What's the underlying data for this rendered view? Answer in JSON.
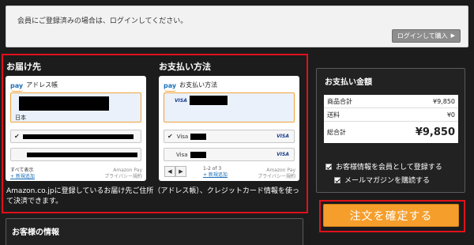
{
  "notice": {
    "text": "会員にご登録済みの場合は、ログインしてください。"
  },
  "login_button": {
    "label": "ログインして購入",
    "icon": "triangle-right-icon"
  },
  "address": {
    "section_title": "お届け先",
    "widget_title": "アドレス帳",
    "brand": "pay",
    "country": "日本",
    "show_all": "すべて表示",
    "add_new": "+ 新規追加",
    "footer_brand": "Amazon Pay",
    "footer_policy": "プライバシー規約"
  },
  "payment": {
    "section_title": "お支払い方法",
    "widget_title": "お支払い方法",
    "brand": "pay",
    "card_brand": "VISA",
    "card_label": "Visa",
    "pager_prev": "◀",
    "pager_next": "▶",
    "pager_text": "1-2 of 3",
    "add_new": "+ 新規追加",
    "footer_brand": "Amazon Pay",
    "footer_policy": "プライバシー規約"
  },
  "left_description": "Amazon.co.jpに登録しているお届け先ご住所（アドレス帳）、クレジットカード情報を使って決済できます。",
  "customer_info": {
    "title": "お客様の情報"
  },
  "summary": {
    "title": "お支払い金額",
    "rows": [
      {
        "label": "商品合計",
        "value": "¥9,850"
      },
      {
        "label": "送料",
        "value": "¥0"
      }
    ],
    "total_label": "総合計",
    "total_value": "¥9,850"
  },
  "options": {
    "register_member": "お客様情報を会員として登録する",
    "newsletter": "メールマガジンを購読する"
  },
  "order_button": {
    "label": "注文を確定する"
  },
  "colors": {
    "accent_red": "#e0101c",
    "order_orange": "#f59e2b",
    "background": "#1c1c1c"
  }
}
